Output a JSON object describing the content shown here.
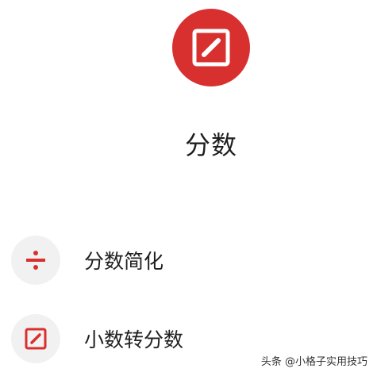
{
  "hero": {
    "icon": "edit-square-icon",
    "color": "#d8302f"
  },
  "page": {
    "title": "分数"
  },
  "menu": {
    "items": [
      {
        "icon": "divide-icon",
        "label": "分数简化"
      },
      {
        "icon": "edit-square-icon",
        "label": "小数转分数"
      }
    ],
    "icon_color": "#d8302f",
    "icon_bg": "#f1f1f1"
  },
  "watermark": {
    "text": "头条 @小格子实用技巧"
  }
}
